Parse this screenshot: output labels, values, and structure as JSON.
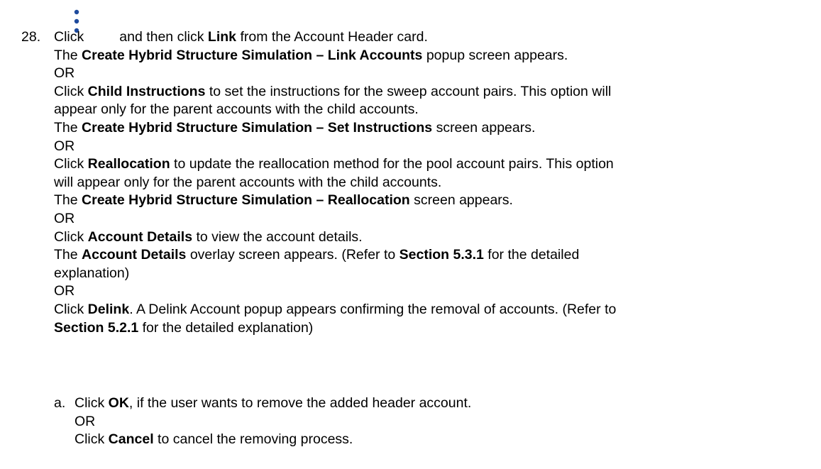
{
  "step": {
    "number": "28.",
    "icon": "kebab-menu-icon",
    "lines": [
      {
        "pre": "Click",
        "b1": "",
        "mid": "and then click",
        "b2": "Link",
        "post": "from the Account Header card."
      },
      {
        "pre": "The",
        "b1": "Create Hybrid Structure Simulation – Link Accounts",
        "mid": "popup screen appears.",
        "b2": "",
        "post": ""
      },
      {
        "pre": "OR",
        "b1": "",
        "mid": "",
        "b2": "",
        "post": ""
      },
      {
        "pre": "Click",
        "b1": "Child Instructions",
        "mid": "to set the instructions for the sweep account pairs. This option will",
        "b2": "",
        "post": ""
      },
      {
        "pre": "appear only for the parent accounts with the child accounts.",
        "b1": "",
        "mid": "",
        "b2": "",
        "post": ""
      },
      {
        "pre": "The",
        "b1": "Create Hybrid Structure Simulation – Set Instructions",
        "mid": "screen appears.",
        "b2": "",
        "post": ""
      },
      {
        "pre": "OR",
        "b1": "",
        "mid": "",
        "b2": "",
        "post": ""
      },
      {
        "pre": "Click",
        "b1": "Reallocation",
        "mid": "to update the reallocation method for the pool account pairs. This option",
        "b2": "",
        "post": ""
      },
      {
        "pre": "will appear only for the parent accounts with the child accounts.",
        "b1": "",
        "mid": "",
        "b2": "",
        "post": ""
      },
      {
        "pre": "The",
        "b1": "Create Hybrid Structure Simulation – Reallocation",
        "mid": "screen appears.",
        "b2": "",
        "post": ""
      },
      {
        "pre": "OR",
        "b1": "",
        "mid": "",
        "b2": "",
        "post": ""
      },
      {
        "pre": "Click",
        "b1": "Account Details",
        "mid": "to view the account details.",
        "b2": "",
        "post": ""
      },
      {
        "pre": "The",
        "b1": "Account Details",
        "mid": "overlay screen appears. (Refer to",
        "b2": "Section 5.3.1",
        "post": "for the detailed"
      },
      {
        "pre": "explanation)",
        "b1": "",
        "mid": "",
        "b2": "",
        "post": ""
      },
      {
        "pre": "OR",
        "b1": "",
        "mid": "",
        "b2": "",
        "post": ""
      },
      {
        "pre": "Click",
        "b1": "Delink",
        "mid": ". A Delink Account popup appears confirming the removal of accounts. (Refer to",
        "b2": "",
        "post": ""
      },
      {
        "pre": "",
        "b1": "Section 5.2.1",
        "mid": "for the detailed explanation)",
        "b2": "",
        "post": ""
      }
    ]
  },
  "substep": {
    "label": "a.",
    "lines": [
      {
        "pre": "Click",
        "b1": "OK",
        "mid": ", if the user wants to remove the added header account."
      },
      {
        "pre": "OR",
        "b1": "",
        "mid": ""
      },
      {
        "pre": "Click",
        "b1": "Cancel",
        "mid": "to cancel the removing process."
      }
    ]
  }
}
